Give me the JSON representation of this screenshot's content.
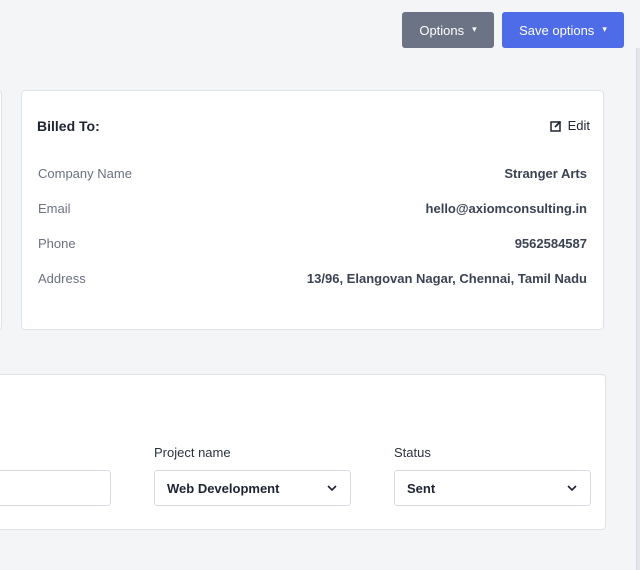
{
  "toolbar": {
    "options_label": "Options",
    "save_options_label": "Save options"
  },
  "billed_to": {
    "title": "Billed To:",
    "edit_label": "Edit",
    "rows": [
      {
        "label": "Company Name",
        "value": "Stranger Arts"
      },
      {
        "label": "Email",
        "value": "hello@axiomconsulting.in"
      },
      {
        "label": "Phone",
        "value": "9562584587"
      },
      {
        "label": "Address",
        "value": "13/96, Elangovan Nagar, Chennai, Tamil Nadu"
      }
    ]
  },
  "project": {
    "project_name_label": "Project name",
    "project_name_value": "Web Development",
    "status_label": "Status",
    "status_value": "Sent"
  },
  "colors": {
    "options_button": "#6c7385",
    "save_button": "#4f6ce8",
    "background": "#f4f5f7"
  },
  "icons": {
    "edit": "edit-icon",
    "chevron": "chevron-down-icon"
  }
}
